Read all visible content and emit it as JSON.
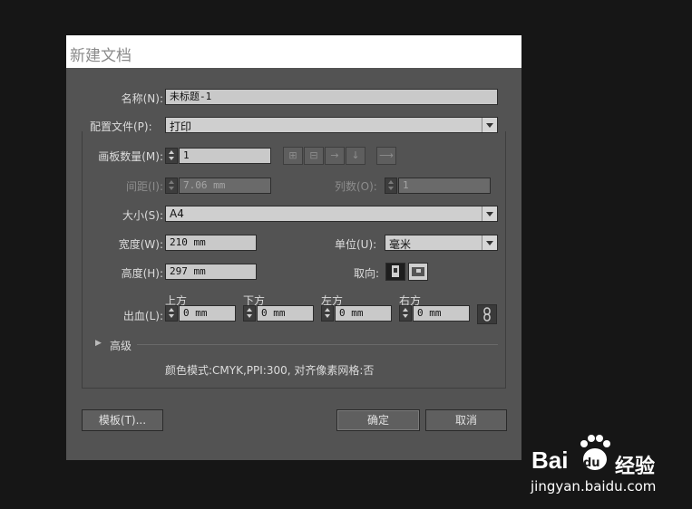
{
  "dialog": {
    "title": "新建文档",
    "name": {
      "label": "名称(N):",
      "value": "未标题-1"
    },
    "profile": {
      "label": "配置文件(P):",
      "value": "打印"
    },
    "artboards": {
      "label": "画板数量(M):",
      "value": "1",
      "arrange_icons": [
        "grid-by-row-icon",
        "grid-by-column-icon",
        "arrange-by-row-icon",
        "arrange-by-column-icon",
        "right-to-left-icon"
      ]
    },
    "spacing": {
      "label": "间距(I):",
      "value": "7.06 mm"
    },
    "columns": {
      "label": "列数(O):",
      "value": "1"
    },
    "size": {
      "label": "大小(S):",
      "value": "A4"
    },
    "width": {
      "label": "宽度(W):",
      "value": "210 mm"
    },
    "units": {
      "label": "单位(U):",
      "value": "毫米"
    },
    "height": {
      "label": "高度(H):",
      "value": "297 mm"
    },
    "orientation": {
      "label": "取向:",
      "selected": "portrait"
    },
    "bleed": {
      "label": "出血(L):",
      "top": {
        "label": "上方",
        "value": "0 mm"
      },
      "bottom": {
        "label": "下方",
        "value": "0 mm"
      },
      "left": {
        "label": "左方",
        "value": "0 mm"
      },
      "right": {
        "label": "右方",
        "value": "0 mm"
      }
    },
    "advanced_label": "高级",
    "summary": "颜色模式:CMYK,PPI:300, 对齐像素网格:否",
    "buttons": {
      "templates": "模板(T)...",
      "ok": "确定",
      "cancel": "取消"
    }
  },
  "watermark": {
    "brand": "Bai",
    "paw_text": "du",
    "cn": "经验",
    "url": "jingyan.baidu.com"
  },
  "colors": {
    "dialog_bg": "#535353",
    "page_bg": "#161616",
    "field_bg": "#c9c9c9"
  }
}
